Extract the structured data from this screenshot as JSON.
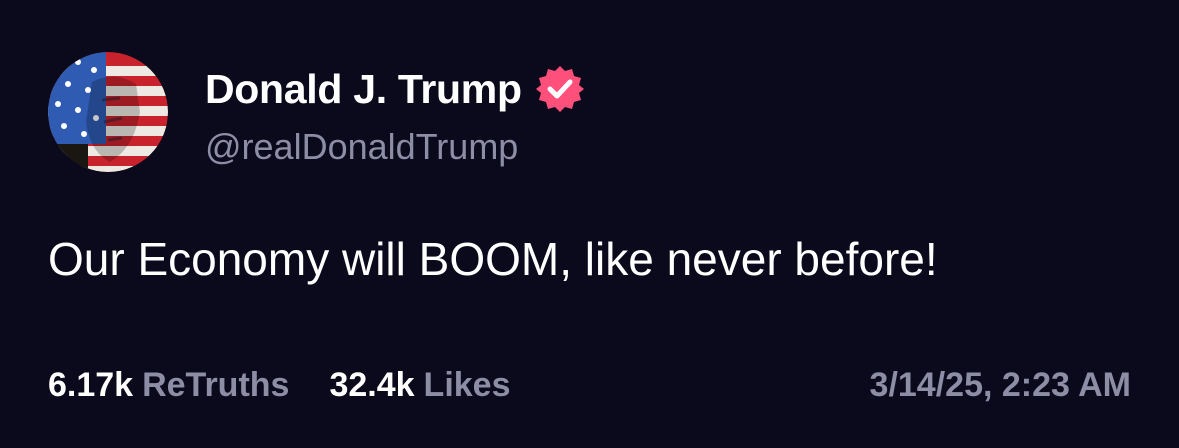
{
  "post": {
    "author": {
      "display_name": "Donald J. Trump",
      "handle": "@realDonaldTrump",
      "verified": true,
      "avatar_icon": "flag-portrait-avatar",
      "verified_icon": "verified-badge-icon"
    },
    "text": "Our Economy will BOOM, like never before!",
    "stats": {
      "retruths_count": "6.17k",
      "retruths_label": "ReTruths",
      "likes_count": "32.4k",
      "likes_label": "Likes"
    },
    "timestamp": "3/14/25, 2:23 AM"
  },
  "colors": {
    "background": "#0b0a1c",
    "text_primary": "#ffffff",
    "text_secondary": "#8e8da6",
    "verified_badge": "#ff4f7b"
  }
}
